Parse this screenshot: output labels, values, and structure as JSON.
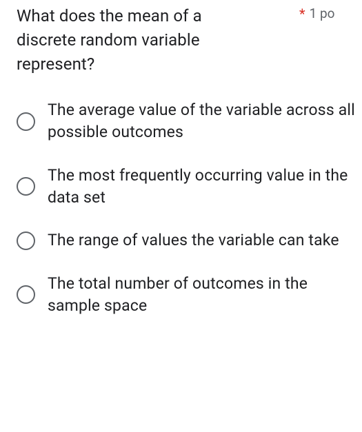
{
  "question": {
    "text": "What does the mean of a discrete random variable represent?",
    "required_marker": "*",
    "points_label": "1 po"
  },
  "options": [
    {
      "label": "The average value of the variable across all possible outcomes"
    },
    {
      "label": "The most frequently occurring value in the data set"
    },
    {
      "label": "The range of values the variable can take"
    },
    {
      "label": "The total number of outcomes in the sample space"
    }
  ]
}
